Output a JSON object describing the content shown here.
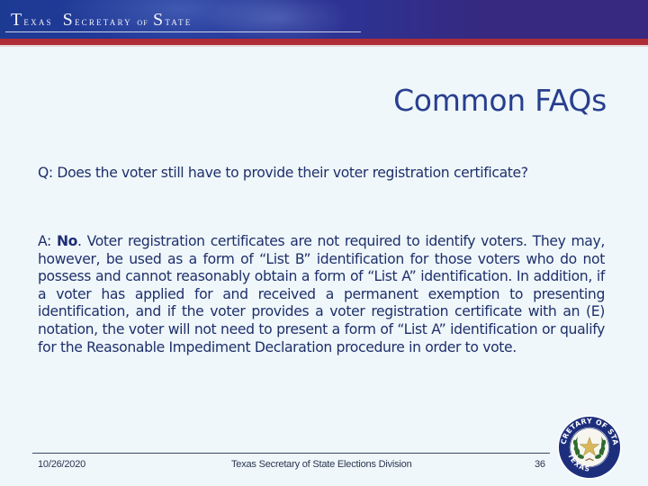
{
  "header": {
    "banner_word_1_initial": "T",
    "banner_word_1_rest": "exas",
    "banner_word_2_initial": "S",
    "banner_word_2_rest": "ecretary",
    "banner_word_3": "of",
    "banner_word_4_initial": "S",
    "banner_word_4_rest": "tate",
    "banner_full_text": "Texas Secretary of State"
  },
  "slide": {
    "title": "Common FAQs",
    "question": "Q: Does the voter still have to provide their voter registration certificate?",
    "answer_prefix": "A: ",
    "answer_emphasis": "No",
    "answer_body": ".  Voter registration certificates are not required to identify voters. They may, however, be used as a form of “List B” identification for those voters who do not possess and cannot reasonably obtain a form of “List A” identification.  In addition, if a voter has applied for and received a permanent exemption to presenting identification, and if the voter provides a voter registration certificate with an (E) notation, the voter will not need to present a form of “List A” identification or qualify for the Reasonable Impediment Declaration procedure in order to vote."
  },
  "footer": {
    "date": "10/26/2020",
    "center": "Texas Secretary of State Elections Division",
    "page_number": "36"
  },
  "seal": {
    "icon": "texas-secretary-of-state-seal-icon",
    "top_text": "SECRETARY OF STATE",
    "bottom_text": "TEXAS"
  },
  "colors": {
    "banner_blue": "#22389a",
    "banner_purple": "#36297f",
    "stripe_red": "#ae2c35",
    "title_blue": "#283f8f",
    "body_text": "#1f2f6b",
    "background": "#eff7fa"
  }
}
